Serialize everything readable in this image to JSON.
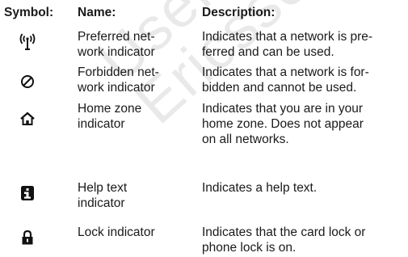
{
  "header": {
    "symbol": "Symbol:",
    "name": "Name:",
    "description": "Description:"
  },
  "rows": [
    {
      "icon": "antenna-icon",
      "name": "Preferred net-\nwork indicator",
      "description": "Indicates that a network is pre-\nferred and can be used."
    },
    {
      "icon": "forbidden-icon",
      "name": "Forbidden net-\nwork indicator",
      "description": "Indicates that a network is for-\nbidden and cannot be used."
    },
    {
      "icon": "home-icon",
      "name": "Home zone\nindicator",
      "description": "Indicates that you are in your\nhome zone. Does not appear\non all networks."
    },
    {
      "icon": "info-icon",
      "name": "Help text\nindicator",
      "description": "Indicates a help text."
    },
    {
      "icon": "lock-icon",
      "name": "Lock indicator",
      "description": "Indicates that the card lock or\nphone lock is on."
    }
  ],
  "watermark": {
    "line1": "Users",
    "line2": "Ericsson AB"
  }
}
